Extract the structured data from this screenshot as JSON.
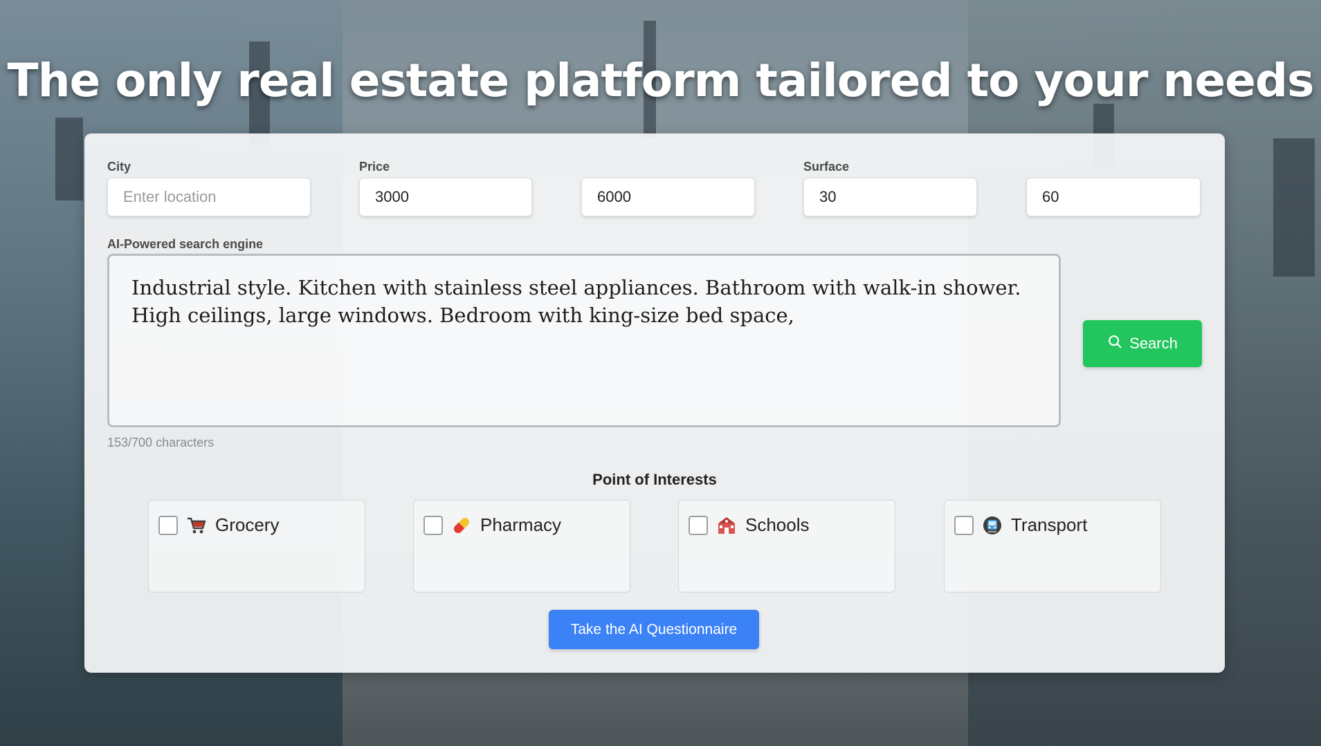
{
  "headline": "The only real estate platform tailored to your needs",
  "form": {
    "city": {
      "label": "City",
      "placeholder": "Enter location",
      "value": ""
    },
    "price": {
      "label": "Price",
      "min": "3000",
      "max": "6000"
    },
    "surface": {
      "label": "Surface",
      "min": "30",
      "max": "60"
    },
    "ai_search": {
      "label": "AI-Powered search engine",
      "value": "Industrial style. Kitchen with stainless steel appliances. Bathroom with walk-in shower. High ceilings, large windows. Bedroom with king-size bed space, ",
      "counter": "153/700 characters"
    },
    "search_button": "Search"
  },
  "poi": {
    "title": "Point of Interests",
    "items": [
      {
        "label": "Grocery",
        "icon": "shopping-cart-icon",
        "checked": false
      },
      {
        "label": "Pharmacy",
        "icon": "pill-icon",
        "checked": false
      },
      {
        "label": "Schools",
        "icon": "school-icon",
        "checked": false
      },
      {
        "label": "Transport",
        "icon": "metro-icon",
        "checked": false
      }
    ]
  },
  "questionnaire_button": "Take the AI Questionnaire",
  "colors": {
    "search": "#22c55e",
    "primary": "#3b82f6"
  }
}
